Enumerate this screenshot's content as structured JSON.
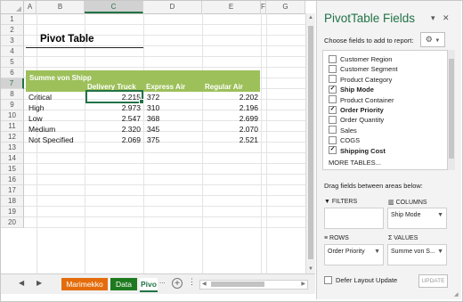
{
  "sheet": {
    "columns": [
      "A",
      "B",
      "C",
      "D",
      "E",
      "F",
      "G"
    ],
    "active_column": "C",
    "rows": [
      "1",
      "2",
      "3",
      "4",
      "5",
      "6",
      "7",
      "8",
      "9",
      "10",
      "11",
      "12",
      "13",
      "14",
      "15",
      "16",
      "17",
      "18",
      "19",
      "20"
    ],
    "active_row": "7",
    "title": "Pivot Table",
    "pivot": {
      "value_header": "Summe von Shipp",
      "column_headers": [
        "Delivery Truck",
        "Express Air",
        "Regular Air"
      ],
      "rows": [
        {
          "label": "Critical",
          "values": [
            "2.215",
            "372",
            "2.202"
          ]
        },
        {
          "label": "High",
          "values": [
            "2.973",
            "310",
            "2.196"
          ]
        },
        {
          "label": "Low",
          "values": [
            "2.547",
            "368",
            "2.699"
          ]
        },
        {
          "label": "Medium",
          "values": [
            "2.320",
            "345",
            "2.070"
          ]
        },
        {
          "label": "Not Specified",
          "values": [
            "2.069",
            "375",
            "2.521"
          ]
        }
      ]
    },
    "colors": {
      "accent": "#217346",
      "pivot_header": "#9dc05a"
    }
  },
  "tabs": {
    "items": [
      {
        "label": "Marimekko",
        "color": "#e46c0a"
      },
      {
        "label": "Data",
        "color": "#1e7a1e"
      },
      {
        "label": "Pivo",
        "color": "#ffffff"
      }
    ],
    "more": "..."
  },
  "pane": {
    "title": "PivotTable Fields",
    "dropdown": "▾",
    "close": "✕",
    "subtitle": "Choose fields to add to report:",
    "fields": [
      {
        "label": "Customer Region",
        "checked": false
      },
      {
        "label": "Customer Segment",
        "checked": false
      },
      {
        "label": "Product Category",
        "checked": false
      },
      {
        "label": "Ship Mode",
        "checked": true
      },
      {
        "label": "Product Container",
        "checked": false
      },
      {
        "label": "Order Priority",
        "checked": true
      },
      {
        "label": "Order Quantity",
        "checked": false
      },
      {
        "label": "Sales",
        "checked": false
      },
      {
        "label": "COGS",
        "checked": false
      },
      {
        "label": "Shipping Cost",
        "checked": true
      }
    ],
    "more_tables": "MORE TABLES...",
    "drag_text": "Drag fields between areas below:",
    "areas": {
      "filters": {
        "label": "FILTERS",
        "value": ""
      },
      "columns": {
        "label": "COLUMNS",
        "value": "Ship Mode"
      },
      "rows": {
        "label": "ROWS",
        "value": "Order Priority"
      },
      "values": {
        "label": "VALUES",
        "value": "Summe von S..."
      }
    },
    "defer_label": "Defer Layout Update",
    "update_label": "UPDATE"
  }
}
